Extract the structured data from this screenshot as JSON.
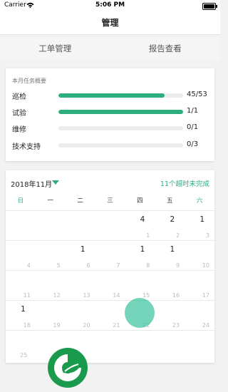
{
  "status_bar": {
    "carrier": "Carrier",
    "time": "5:06 PM",
    "battery_level": 1.0
  },
  "nav": {
    "title": "管理"
  },
  "tabs": [
    {
      "label": "工单管理"
    },
    {
      "label": "报告查看"
    }
  ],
  "summary": {
    "title": "本月任务概要",
    "tasks": [
      {
        "label": "巡检",
        "count": "45/53",
        "progress": 0.849
      },
      {
        "label": "试验",
        "count": "1/1",
        "progress": 1.0
      },
      {
        "label": "维修",
        "count": "0/1",
        "progress": 0.0
      },
      {
        "label": "技术支持",
        "count": "0/3",
        "progress": 0.0
      }
    ]
  },
  "calendar": {
    "month_label": "2018年11月",
    "overdue_text": "11个超时未完成",
    "weekdays": [
      "日",
      "一",
      "二",
      "三",
      "四",
      "五",
      "六"
    ],
    "weeks": [
      [
        {
          "day": "",
          "count": ""
        },
        {
          "day": "",
          "count": ""
        },
        {
          "day": "",
          "count": ""
        },
        {
          "day": "",
          "count": ""
        },
        {
          "day": "1",
          "count": "4"
        },
        {
          "day": "2",
          "count": "2"
        },
        {
          "day": "3",
          "count": "1"
        }
      ],
      [
        {
          "day": "4",
          "count": ""
        },
        {
          "day": "5",
          "count": ""
        },
        {
          "day": "6",
          "count": "1"
        },
        {
          "day": "7",
          "count": ""
        },
        {
          "day": "8",
          "count": "1"
        },
        {
          "day": "9",
          "count": "1"
        },
        {
          "day": "10",
          "count": ""
        }
      ],
      [
        {
          "day": "11",
          "count": ""
        },
        {
          "day": "12",
          "count": ""
        },
        {
          "day": "13",
          "count": ""
        },
        {
          "day": "14",
          "count": ""
        },
        {
          "day": "15",
          "count": ""
        },
        {
          "day": "16",
          "count": ""
        },
        {
          "day": "17",
          "count": ""
        }
      ],
      [
        {
          "day": "18",
          "count": "1"
        },
        {
          "day": "19",
          "count": ""
        },
        {
          "day": "20",
          "count": ""
        },
        {
          "day": "21",
          "count": ""
        },
        {
          "day": "22",
          "count": ""
        },
        {
          "day": "23",
          "count": ""
        },
        {
          "day": "24",
          "count": ""
        }
      ],
      [
        {
          "day": "25",
          "count": ""
        },
        {
          "day": "",
          "count": ""
        },
        {
          "day": "",
          "count": ""
        },
        {
          "day": "",
          "count": ""
        },
        {
          "day": "",
          "count": ""
        },
        {
          "day": "",
          "count": ""
        },
        {
          "day": "",
          "count": ""
        }
      ]
    ]
  },
  "colors": {
    "accent": "#2cae7f",
    "fab": "#3fc49e",
    "logo_green": "#1a9a4c"
  },
  "icons": {
    "wifi": "wifi-icon",
    "battery": "battery-icon",
    "dropdown": "caret-down-icon",
    "logo": "leaf-logo-icon",
    "fab": "floating-action-button"
  }
}
